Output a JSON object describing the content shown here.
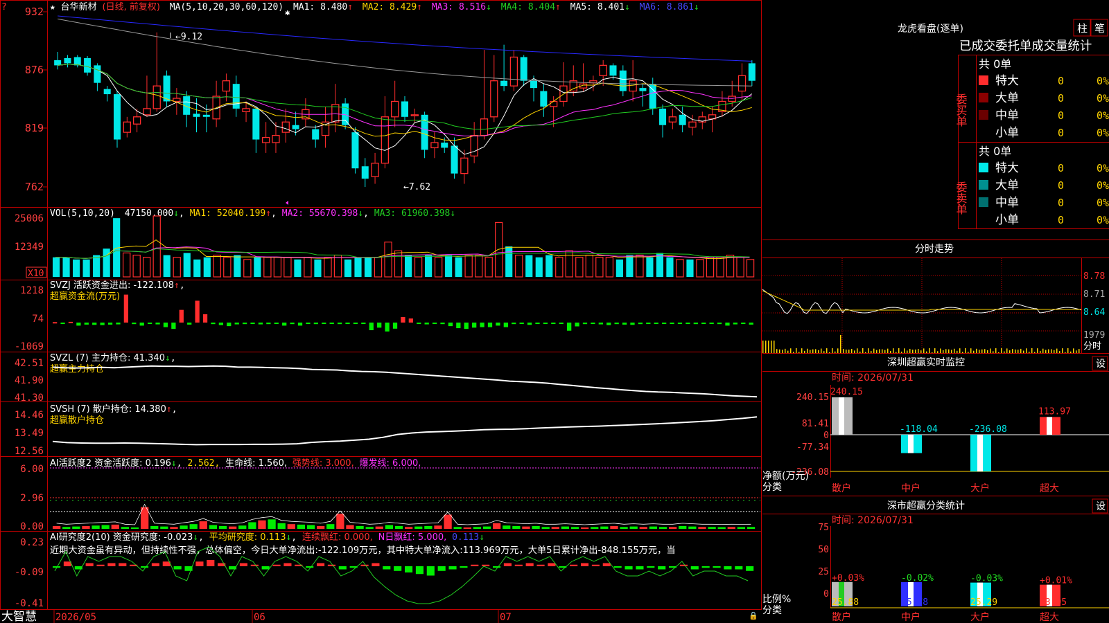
{
  "colors": {
    "up": "#ff2d2d",
    "down": "#00e8e8",
    "bg": "#000000",
    "frame": "#c00000",
    "yellow": "#ffd400",
    "magenta": "#ff33ff",
    "green": "#22cc22",
    "white": "#ffffff",
    "blue": "#2828ff",
    "gray": "#9a9a9a"
  },
  "header": {
    "star": "★",
    "stock": "台华新材",
    "mode": "(日线, 前复权)",
    "ma_label": "MA(5,10,20,30,60,120)",
    "ma": [
      {
        "name": "MA1: 8.480",
        "arrow": "↑"
      },
      {
        "name": "MA2: 8.429",
        "arrow": "↑"
      },
      {
        "name": "MA3: 8.516",
        "arrow": "↓"
      },
      {
        "name": "MA4: 8.404",
        "arrow": "↑"
      },
      {
        "name": "MA5: 8.401",
        "arrow": "↓"
      },
      {
        "name": "MA6: 8.861",
        "arrow": "↓"
      }
    ]
  },
  "axes": {
    "price": [
      "932",
      "876",
      "819",
      "762"
    ],
    "vol": [
      "25006",
      "12349",
      "X10"
    ],
    "svzj": [
      "1218",
      "74",
      "-1069"
    ],
    "svzl": [
      "42.51",
      "41.90",
      "41.30"
    ],
    "svsh": [
      "14.46",
      "13.49",
      "12.56"
    ],
    "ai1": [
      "6.00",
      "2.96",
      "0.00"
    ],
    "ai2": [
      "0.23",
      "-0.09",
      "-0.41"
    ]
  },
  "annotations": {
    "high": "9.12",
    "low": "7.62",
    "high_arrow": "←",
    "low_arrow": "←"
  },
  "panels": {
    "vol": {
      "label": "VOL(5,10,20)",
      "value": "47150.000",
      "a0": "↓",
      "ma1": "MA1: 52040.199",
      "a1": "↑",
      "ma2": "MA2: 55670.398",
      "a2": "↓",
      "ma3": "MA3: 61960.398",
      "a3": "↓"
    },
    "svzj": {
      "label": "SVZJ  活跃资金进出: -122.108",
      "a": "↑",
      "sub": "超赢资金流(万元)"
    },
    "svzl": {
      "label": "SVZL (7) 主力持仓: 41.340",
      "a": "↓",
      "sub": "超赢主力持仓"
    },
    "svsh": {
      "label": "SVSH (7) 散户持仓: 14.380",
      "a": "↑",
      "sub": "超赢散户持仓"
    },
    "ai1": {
      "label": "AI活跃度2 资金活跃度: 0.196",
      "a": "↓",
      "v2": "2.562,",
      "v3": "生命线: 1.560,",
      "v4": "强势线: 3.000,",
      "v5": "爆发线: 6.000,"
    },
    "ai2": {
      "label": "AI研究度2(10) 资金研究度: -0.023",
      "a": "↓",
      "v2": "平均研究度: 0.113",
      "a2": "↓",
      "v3": "连续飘红: 0.000,",
      "v4": "N日飘红: 5.000,",
      "v5": "0.113",
      "a5": "↓",
      "text": "近期大资金虽有异动，但持续性不强，总体偏空，今日大单净流出:-122.109万元，其中特大单净流入:113.969万元，大单5日累计净出-848.155万元，当"
    }
  },
  "bottom": {
    "brand": "大智慧",
    "dates": [
      "2026/05",
      "06",
      "07"
    ]
  },
  "right": {
    "lhb": {
      "title": "龙虎看盘(逐单)",
      "btn1": "柱",
      "btn2": "笔",
      "subtitle": "已成交委托单成交量统计",
      "buy": {
        "total": "共 0单",
        "side": "委买单",
        "rows": [
          {
            "name": "特大",
            "v": "0",
            "p": "0%"
          },
          {
            "name": "大单",
            "v": "0",
            "p": "0%"
          },
          {
            "name": "中单",
            "v": "0",
            "p": "0%"
          },
          {
            "name": "小单",
            "v": "0",
            "p": "0%"
          }
        ]
      },
      "sell": {
        "total": "共 0单",
        "side": "委卖单",
        "rows": [
          {
            "name": "特大",
            "v": "0",
            "p": "0%"
          },
          {
            "name": "大单",
            "v": "0",
            "p": "0%"
          },
          {
            "name": "中单",
            "v": "0",
            "p": "0%"
          },
          {
            "name": "小单",
            "v": "0",
            "p": "0%"
          }
        ]
      }
    },
    "fs": {
      "title": "分时走势",
      "p1": "8.78",
      "p2": "8.71",
      "p3": "8.64",
      "vol": "1979",
      "unit": "分时"
    },
    "sz": {
      "title": "深圳超赢实时监控",
      "btn": "设",
      "time": "时间: 2026/07/31",
      "ticks": [
        "240.15",
        "81.41",
        "0",
        "-77.34",
        "-236.08"
      ],
      "ylabel": "净额(万元)",
      "xlabel": "分类",
      "cats": [
        "散户",
        "中户",
        "大户",
        "超大"
      ],
      "values": [
        "240.15",
        "-118.04",
        "-236.08",
        "113.97"
      ]
    },
    "ss": {
      "title": "深市超赢分类统计",
      "btn": "设",
      "time": "时间: 2026/07/31",
      "ticks": [
        "75",
        "50",
        "25",
        "0"
      ],
      "ylabel": "比例%",
      "xlabel": "分类",
      "cats": [
        "散户",
        "中户",
        "大户",
        "超大"
      ],
      "top": [
        "+0.03%",
        "-0.02%",
        "-0.03%",
        "+0.01%"
      ],
      "bottom": [
        "25.88",
        "25.78",
        "25.29",
        "23.05"
      ]
    }
  },
  "chart_data": [
    {
      "type": "candlestick",
      "title": "台华新材 (日线, 前复权)",
      "ylim": [
        762,
        932
      ],
      "y_unit": "price ×100",
      "annotations": [
        {
          "label": "9.12",
          "type": "high"
        },
        {
          "label": "7.62",
          "type": "low"
        }
      ],
      "candles": [
        {
          "o": 885,
          "c": 880,
          "h": 893,
          "l": 876
        },
        {
          "o": 887,
          "c": 882,
          "h": 890,
          "l": 878
        },
        {
          "o": 888,
          "c": 880,
          "h": 890,
          "l": 878
        },
        {
          "o": 887,
          "c": 873,
          "h": 889,
          "l": 870
        },
        {
          "o": 880,
          "c": 863,
          "h": 882,
          "l": 855
        },
        {
          "o": 857,
          "c": 852,
          "h": 860,
          "l": 845
        },
        {
          "o": 852,
          "c": 808,
          "h": 855,
          "l": 800
        },
        {
          "o": 815,
          "c": 825,
          "h": 830,
          "l": 810
        },
        {
          "o": 823,
          "c": 830,
          "h": 838,
          "l": 815
        },
        {
          "o": 832,
          "c": 838,
          "h": 870,
          "l": 830
        },
        {
          "o": 838,
          "c": 860,
          "h": 912,
          "l": 835
        },
        {
          "o": 870,
          "c": 845,
          "h": 875,
          "l": 840
        },
        {
          "o": 845,
          "c": 848,
          "h": 858,
          "l": 832
        },
        {
          "o": 850,
          "c": 832,
          "h": 855,
          "l": 820
        },
        {
          "o": 833,
          "c": 830,
          "h": 848,
          "l": 815
        },
        {
          "o": 832,
          "c": 830,
          "h": 842,
          "l": 815
        },
        {
          "o": 828,
          "c": 850,
          "h": 865,
          "l": 820
        },
        {
          "o": 855,
          "c": 865,
          "h": 872,
          "l": 845
        },
        {
          "o": 862,
          "c": 838,
          "h": 870,
          "l": 830
        },
        {
          "o": 835,
          "c": 838,
          "h": 845,
          "l": 825
        },
        {
          "o": 838,
          "c": 808,
          "h": 840,
          "l": 795
        },
        {
          "o": 805,
          "c": 810,
          "h": 825,
          "l": 795
        },
        {
          "o": 805,
          "c": 812,
          "h": 825,
          "l": 795
        },
        {
          "o": 815,
          "c": 825,
          "h": 838,
          "l": 805
        },
        {
          "o": 822,
          "c": 818,
          "h": 835,
          "l": 812
        },
        {
          "o": 828,
          "c": 837,
          "h": 848,
          "l": 820
        },
        {
          "o": 818,
          "c": 808,
          "h": 822,
          "l": 800
        },
        {
          "o": 812,
          "c": 825,
          "h": 840,
          "l": 800
        },
        {
          "o": 825,
          "c": 842,
          "h": 862,
          "l": 815
        },
        {
          "o": 843,
          "c": 822,
          "h": 848,
          "l": 818
        },
        {
          "o": 815,
          "c": 780,
          "h": 820,
          "l": 775
        },
        {
          "o": 782,
          "c": 770,
          "h": 790,
          "l": 762
        },
        {
          "o": 772,
          "c": 785,
          "h": 795,
          "l": 765
        },
        {
          "o": 785,
          "c": 830,
          "h": 850,
          "l": 780
        },
        {
          "o": 830,
          "c": 845,
          "h": 865,
          "l": 820
        },
        {
          "o": 845,
          "c": 830,
          "h": 850,
          "l": 825
        },
        {
          "o": 832,
          "c": 832,
          "h": 838,
          "l": 825
        },
        {
          "o": 832,
          "c": 798,
          "h": 835,
          "l": 790
        },
        {
          "o": 800,
          "c": 805,
          "h": 815,
          "l": 790
        },
        {
          "o": 805,
          "c": 800,
          "h": 810,
          "l": 795
        },
        {
          "o": 802,
          "c": 775,
          "h": 810,
          "l": 770
        },
        {
          "o": 775,
          "c": 790,
          "h": 798,
          "l": 765
        },
        {
          "o": 792,
          "c": 812,
          "h": 825,
          "l": 785
        },
        {
          "o": 812,
          "c": 828,
          "h": 895,
          "l": 808
        },
        {
          "o": 830,
          "c": 865,
          "h": 890,
          "l": 825
        },
        {
          "o": 865,
          "c": 860,
          "h": 900,
          "l": 855
        },
        {
          "o": 860,
          "c": 888,
          "h": 895,
          "l": 855
        },
        {
          "o": 888,
          "c": 865,
          "h": 890,
          "l": 860
        },
        {
          "o": 865,
          "c": 858,
          "h": 870,
          "l": 845
        },
        {
          "o": 855,
          "c": 840,
          "h": 862,
          "l": 830
        },
        {
          "o": 840,
          "c": 845,
          "h": 850,
          "l": 820
        },
        {
          "o": 845,
          "c": 860,
          "h": 883,
          "l": 840
        },
        {
          "o": 855,
          "c": 865,
          "h": 880,
          "l": 850
        },
        {
          "o": 858,
          "c": 862,
          "h": 882,
          "l": 855
        },
        {
          "o": 863,
          "c": 865,
          "h": 870,
          "l": 855
        },
        {
          "o": 870,
          "c": 880,
          "h": 885,
          "l": 860
        },
        {
          "o": 880,
          "c": 870,
          "h": 882,
          "l": 866
        },
        {
          "o": 875,
          "c": 855,
          "h": 880,
          "l": 850
        },
        {
          "o": 855,
          "c": 865,
          "h": 885,
          "l": 845
        },
        {
          "o": 858,
          "c": 855,
          "h": 862,
          "l": 840
        },
        {
          "o": 862,
          "c": 838,
          "h": 868,
          "l": 832
        },
        {
          "o": 838,
          "c": 822,
          "h": 842,
          "l": 810
        },
        {
          "o": 825,
          "c": 830,
          "h": 838,
          "l": 818
        },
        {
          "o": 832,
          "c": 822,
          "h": 840,
          "l": 815
        },
        {
          "o": 820,
          "c": 825,
          "h": 832,
          "l": 812
        },
        {
          "o": 825,
          "c": 830,
          "h": 835,
          "l": 818
        },
        {
          "o": 828,
          "c": 832,
          "h": 840,
          "l": 815
        },
        {
          "o": 835,
          "c": 845,
          "h": 855,
          "l": 830
        },
        {
          "o": 845,
          "c": 850,
          "h": 865,
          "l": 840
        },
        {
          "o": 855,
          "c": 870,
          "h": 882,
          "l": 845
        },
        {
          "o": 882,
          "c": 865,
          "h": 885,
          "l": 860
        }
      ]
    },
    {
      "type": "bar",
      "title": "VOL(5,10,20)",
      "ylim": [
        0,
        25006
      ],
      "values": [
        9,
        9,
        8,
        8,
        10,
        13,
        27,
        11,
        10,
        9,
        28,
        10,
        9,
        11,
        8,
        9,
        10,
        9,
        10,
        8,
        9,
        9,
        9,
        9,
        8,
        9,
        8,
        9,
        10,
        8,
        9,
        9,
        9,
        16,
        12,
        10,
        9,
        10,
        9,
        10,
        9,
        10,
        10,
        9,
        25,
        14,
        10,
        10,
        9,
        10,
        9,
        12,
        9,
        10,
        9,
        9,
        8,
        10,
        10,
        9,
        11,
        9,
        8,
        8,
        8,
        9,
        9,
        10,
        9,
        8
      ]
    },
    {
      "type": "bar",
      "title": "超赢资金流(万元)",
      "ylim": [
        -1069,
        1218
      ],
      "values": [
        20,
        -10,
        30,
        -120,
        -80,
        -90,
        -100,
        -80,
        -70,
        1100,
        -60,
        -120,
        -40,
        -70,
        -180,
        -250,
        500,
        -80,
        860,
        330,
        -60,
        -100,
        -140,
        -70,
        -60,
        -50,
        -70,
        -60,
        -40,
        -120,
        -60,
        -120,
        -40,
        -60,
        -20,
        -30,
        -60,
        -20,
        -50,
        -40,
        -300,
        -200,
        -350,
        -240,
        220,
        160,
        -40,
        -70,
        -30,
        -60,
        -140,
        -220,
        -250,
        -200,
        -180,
        -180,
        -120,
        -180,
        -60,
        -30,
        -90,
        -40,
        -30,
        -20,
        -30,
        -320,
        -150,
        -60,
        -40,
        -70,
        -100,
        -60,
        -80,
        -90,
        -60,
        -40,
        -50,
        -40,
        -50,
        -40,
        -30,
        -60,
        -20,
        -40,
        -60,
        -120,
        -70,
        -40,
        -80
      ]
    },
    {
      "type": "line",
      "title": "超赢主力持仓",
      "ylim": [
        41.3,
        42.51
      ],
      "values": [
        42.38,
        42.36,
        42.35,
        42.36,
        42.37,
        42.36,
        42.38,
        42.4,
        42.42,
        42.41,
        42.41,
        42.4,
        42.41,
        42.42,
        42.41,
        42.38,
        42.38,
        42.37,
        42.36,
        42.35,
        42.33,
        42.3,
        42.29,
        42.28,
        42.25,
        42.23,
        42.22,
        42.2,
        42.17,
        42.14,
        42.11,
        42.08,
        42.05,
        42.02,
        41.99,
        41.96,
        41.93,
        41.89,
        41.87,
        41.85,
        41.82,
        41.78,
        41.74,
        41.7,
        41.66,
        41.63,
        41.59,
        41.56,
        41.53,
        41.51,
        41.5,
        41.48,
        41.46,
        41.44,
        41.41,
        41.38,
        41.36,
        41.34
      ]
    },
    {
      "type": "line",
      "title": "超赢散户持仓",
      "ylim": [
        12.56,
        14.46
      ],
      "values": [
        13.08,
        13.02,
        13.0,
        12.99,
        12.99,
        13.0,
        12.99,
        12.97,
        12.95,
        12.93,
        12.91,
        12.92,
        12.92,
        12.92,
        12.93,
        12.93,
        12.94,
        12.96,
        13.03,
        13.07,
        13.1,
        13.15,
        13.2,
        13.3,
        13.45,
        13.53,
        13.58,
        13.6,
        13.63,
        13.66,
        13.7,
        13.72,
        13.73,
        13.76,
        13.79,
        13.82,
        13.85,
        13.87,
        13.89,
        13.92,
        13.95,
        13.98,
        14.01,
        14.05,
        14.09,
        14.13,
        14.18,
        14.24,
        14.3,
        14.38
      ]
    },
    {
      "type": "bar",
      "title": "AI活跃度2 资金活跃度",
      "ylim": [
        0,
        6.0
      ],
      "reference_lines": [
        1.56,
        3.0,
        6.0
      ],
      "values": [
        0.3,
        0.2,
        0.25,
        0.3,
        0.35,
        0.4,
        0.45,
        0.2,
        0.15,
        2.3,
        0.3,
        0.25,
        0.2,
        0.35,
        0.5,
        0.8,
        0.4,
        0.3,
        0.25,
        0.35,
        0.7,
        0.9,
        1.0,
        0.6,
        0.5,
        0.45,
        0.4,
        0.3,
        0.5,
        1.6,
        0.4,
        0.3,
        0.2,
        0.25,
        0.4,
        0.3,
        0.2,
        0.25,
        0.3,
        0.35,
        1.5,
        0.2,
        0.15,
        0.2,
        0.25,
        0.6,
        0.35,
        0.3,
        0.25,
        0.3,
        0.2,
        0.2,
        0.25,
        0.2,
        0.15,
        0.2,
        0.25,
        0.3,
        0.2,
        0.25,
        0.2,
        0.25,
        0.2,
        0.2,
        0.3,
        0.25,
        0.2,
        0.2,
        0.18,
        0.2,
        0.19,
        0.2
      ]
    },
    {
      "type": "bar",
      "title": "AI研究度2(10) 资金研究度",
      "ylim": [
        -0.41,
        0.23
      ],
      "values": [
        -0.01,
        0.03,
        -0.02,
        0.02,
        0.01,
        0.02,
        0.02,
        0.01,
        -0.01,
        0.02,
        0.03,
        -0.02,
        -0.03,
        0.03,
        0.04,
        0.02,
        -0.02,
        0.02,
        0.01,
        -0.02,
        0.01,
        0.02,
        0.01,
        -0.01,
        0.02,
        0.01,
        -0.02,
        -0.01,
        0.01,
        0.02,
        -0.02,
        -0.03,
        -0.04,
        -0.05,
        -0.06,
        -0.03,
        -0.02,
        -0.01,
        0.01,
        0.01,
        -0.01,
        0.02,
        0.01,
        0.02,
        0.01,
        0.02,
        -0.01,
        0.01,
        0.02,
        0.01,
        0.02,
        -0.01,
        -0.02,
        -0.02,
        -0.01,
        -0.02,
        -0.01,
        0.01,
        -0.02,
        -0.01,
        -0.01,
        -0.02,
        -0.02,
        -0.03
      ]
    },
    {
      "type": "bar",
      "title": "深圳超赢实时监控",
      "categories": [
        "散户",
        "中户",
        "大户",
        "超大"
      ],
      "values": [
        240.15,
        -118.04,
        -236.08,
        113.97
      ],
      "ylabel": "净额(万元)",
      "xlabel": "分类",
      "ylim": [
        -236.08,
        240.15
      ]
    },
    {
      "type": "bar",
      "title": "深市超赢分类统计",
      "categories": [
        "散户",
        "中户",
        "大户",
        "超大"
      ],
      "values": [
        25.88,
        25.78,
        25.29,
        23.05
      ],
      "changes": [
        "+0.03%",
        "-0.02%",
        "-0.03%",
        "+0.01%"
      ],
      "ylabel": "比例%",
      "xlabel": "分类",
      "ylim": [
        0,
        75
      ]
    }
  ]
}
